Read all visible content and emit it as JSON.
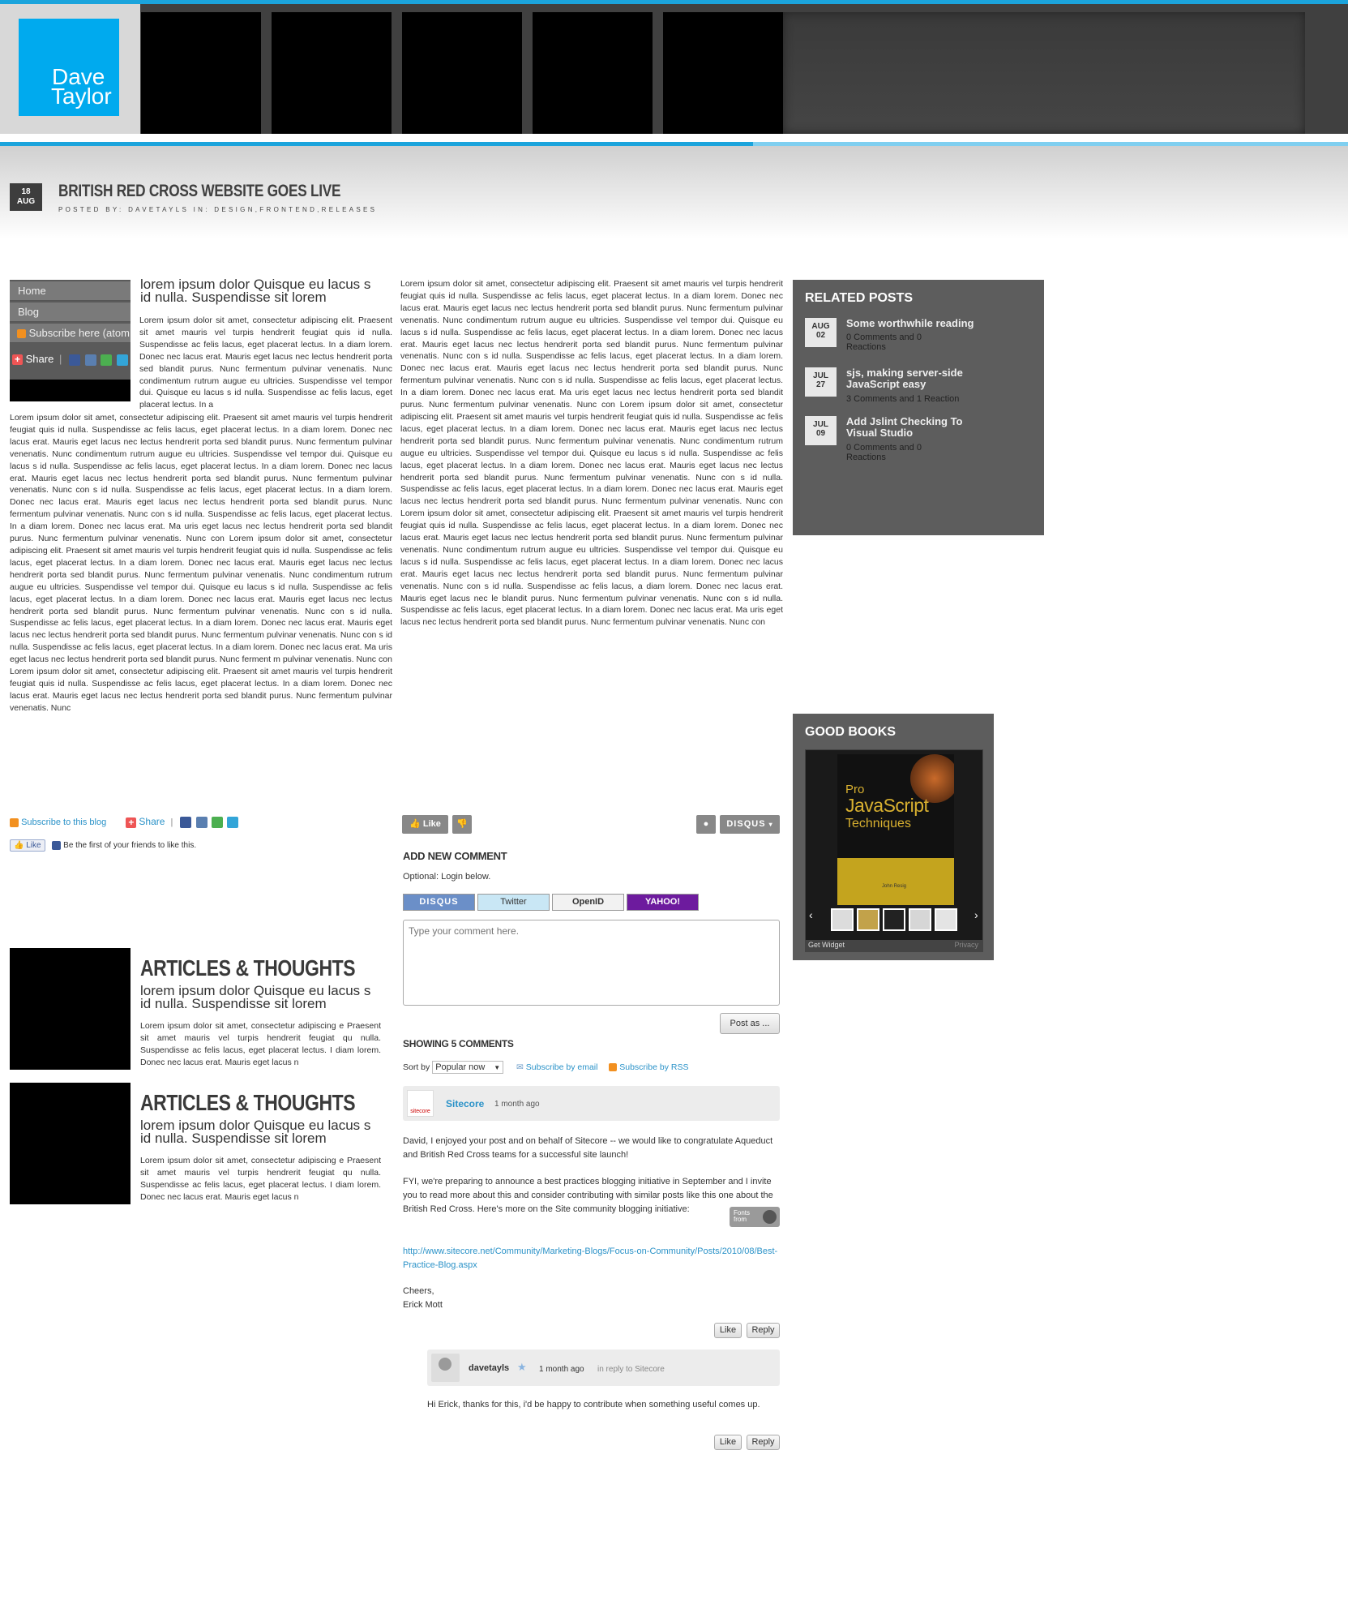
{
  "header": {
    "logo_line1": "Dave",
    "logo_line2": "Taylor"
  },
  "post": {
    "date_day": "18",
    "date_month": "AUG",
    "title": "BRITISH RED CROSS WEBSITE GOES LIVE",
    "meta": "POSTED BY: DAVETAYLS IN: DESIGN,FRONTEND,RELEASES"
  },
  "leftnav": {
    "items": [
      "Home",
      "Blog",
      "Subscribe here (atom"
    ],
    "share": "Share"
  },
  "content": {
    "lead": "lorem ipsum dolor Quisque eu lacus s id nulla. Suspendisse  sit lorem",
    "intro": "Lorem ipsum dolor sit amet, consectetur adipiscing elit. Praesent sit amet mauris vel turpis hendrerit feugiat quis id nulla. Suspendisse ac felis lacus, eget placerat lectus. In a diam lorem. Donec nec lacus erat. Mauris eget lacus nec lectus hendrerit porta sed blandit purus. Nunc fermentum pulvinar venenatis. Nunc condimentum rutrum augue eu ultricies. Suspendisse vel tempor dui. Quisque eu lacus s id nulla. Suspendisse ac felis lacus, eget placerat lectus. In a",
    "col1": "Lorem ipsum dolor sit amet, consectetur adipiscing elit. Praesent sit amet mauris vel turpis hendrerit feugiat quis id nulla. Suspendisse ac felis lacus, eget placerat lectus. In a diam lorem. Donec nec lacus erat. Mauris eget lacus nec lectus hendrerit porta sed blandit purus. Nunc fermentum pulvinar venenatis. Nunc condimentum rutrum augue eu ultricies. Suspendisse vel tempor dui. Quisque eu lacus s id nulla. Suspendisse ac felis lacus, eget placerat lectus. In a diam lorem. Donec nec lacus erat. Mauris eget lacus nec lectus hendrerit porta sed blandit purus. Nunc fermentum pulvinar venenatis. Nunc con s id nulla. Suspendisse ac felis lacus, eget placerat lectus. In a diam lorem. Donec nec lacus erat. Mauris eget lacus nec lectus hendrerit porta sed blandit purus. Nunc fermentum pulvinar venenatis. Nunc con s id nulla. Suspendisse ac felis lacus, eget placerat lectus. In a diam lorem. Donec nec lacus erat. Ma uris eget lacus nec lectus hendrerit porta sed blandit purus. Nunc fermentum pulvinar venenatis. Nunc con Lorem ipsum dolor sit amet, consectetur adipiscing elit. Praesent sit amet mauris vel turpis hendrerit feugiat quis id nulla. Suspendisse ac felis lacus, eget placerat lectus. In a diam lorem. Donec nec lacus erat. Mauris eget lacus nec lectus hendrerit porta sed blandit purus. Nunc fermentum pulvinar venenatis. Nunc condimentum rutrum augue eu ultricies. Suspendisse vel tempor dui. Quisque eu lacus s id nulla. Suspendisse ac felis lacus, eget placerat lectus. In a diam lorem. Donec nec lacus erat. Mauris eget lacus nec lectus hendrerit porta sed blandit purus. Nunc fermentum pulvinar venenatis. Nunc con s id nulla. Suspendisse ac felis lacus, eget placerat lectus. In a diam lorem. Donec nec lacus erat. Mauris eget lacus nec lectus hendrerit porta sed blandit purus. Nunc fermentum pulvinar venenatis. Nunc con s id nulla. Suspendisse ac felis lacus, eget placerat lectus. In a diam lorem. Donec nec lacus erat. Ma uris eget lacus nec lectus hendrerit porta sed blandit purus. Nunc ferment m pulvinar venenatis. Nunc con Lorem ipsum dolor sit amet, consectetur adipiscing elit. Praesent sit amet mauris vel turpis hendrerit feugiat quis id nulla. Suspendisse ac felis lacus, eget placerat lectus. In a diam lorem. Donec nec lacus erat. Mauris eget lacus nec lectus hendrerit porta sed blandit purus. Nunc fermentum pulvinar venenatis. Nunc",
    "col2": "Lorem ipsum dolor sit amet, consectetur adipiscing elit. Praesent sit amet mauris vel turpis hendrerit feugiat quis id nulla. Suspendisse ac felis lacus, eget placerat lectus. In a diam lorem. Donec nec lacus erat. Mauris eget lacus nec lectus hendrerit porta sed blandit purus. Nunc fermentum pulvinar venenatis. Nunc condimentum rutrum augue eu ultricies. Suspendisse vel tempor dui. Quisque eu lacus s id nulla. Suspendisse ac felis lacus, eget placerat lectus. In a diam lorem. Donec nec lacus erat. Mauris eget lacus nec lectus hendrerit porta sed blandit purus. Nunc fermentum pulvinar venenatis. Nunc con s id nulla. Suspendisse ac felis lacus, eget placerat lectus. In a diam lorem. Donec nec lacus erat. Mauris eget lacus nec lectus hendrerit porta sed blandit purus. Nunc fermentum pulvinar venenatis. Nunc con s id nulla. Suspendisse ac felis lacus, eget placerat lectus. In a diam lorem. Donec nec lacus erat. Ma uris eget lacus nec lectus hendrerit porta sed blandit purus. Nunc fermentum pulvinar venenatis. Nunc con Lorem ipsum dolor sit amet, consectetur adipiscing elit. Praesent sit amet mauris vel turpis hendrerit feugiat quis id nulla. Suspendisse ac felis lacus, eget placerat lectus. In a diam lorem. Donec nec lacus erat. Mauris eget lacus nec lectus hendrerit porta sed blandit purus. Nunc fermentum pulvinar venenatis. Nunc condimentum rutrum augue eu ultricies. Suspendisse vel tempor dui. Quisque eu lacus s id nulla. Suspendisse ac felis lacus, eget placerat lectus. In a diam lorem. Donec nec lacus erat. Mauris eget lacus nec lectus hendrerit porta sed blandit purus. Nunc fermentum pulvinar venenatis. Nunc con s id nulla. Suspendisse ac felis lacus, eget placerat lectus. In a diam lorem. Donec nec lacus erat. Mauris eget lacus nec lectus hendrerit porta sed blandit purus. Nunc fermentum pulvinar venenatis. Nunc con Lorem ipsum dolor sit amet, consectetur adipiscing elit. Praesent sit amet mauris vel turpis hendrerit feugiat quis id nulla. Suspendisse ac felis lacus, eget placerat lectus. In a diam lorem. Donec nec lacus erat. Mauris eget lacus nec lectus hendrerit porta sed blandit purus. Nunc fermentum pulvinar venenatis. Nunc condimentum rutrum augue eu ultricies. Suspendisse vel tempor dui. Quisque eu lacus s id nulla. Suspendisse ac felis lacus, eget placerat lectus. In a diam lorem. Donec nec lacus erat. Mauris eget lacus nec lectus hendrerit porta sed blandit purus. Nunc fermentum pulvinar venenatis. Nunc con s id nulla. Suspendisse ac felis lacus, a diam lorem. Donec nec lacus erat. Mauris eget lacus nec le blandit purus. Nunc fermentum pulvinar venenatis. Nunc con s id nulla. Suspendisse ac felis lacus, eget placerat lectus. In a diam lorem. Donec nec lacus erat. Ma uris eget lacus nec lectus hendrerit porta sed blandit purus. Nunc fermentum pulvinar venenatis. Nunc con"
  },
  "share_bar": {
    "subscribe": "Subscribe to this blog",
    "share": "Share",
    "like": "Like",
    "friends": "Be the first of your friends to like this."
  },
  "articles": [
    {
      "heading": "ARTICLES & THOUGHTS",
      "lead": "lorem ipsum dolor Quisque eu lacus s id nulla. Suspendisse  sit lorem",
      "text": "Lorem ipsum dolor sit amet, consectetur adipiscing e Praesent sit amet mauris vel turpis hendrerit feugiat qu nulla. Suspendisse ac felis lacus, eget placerat lectus. I diam lorem. Donec nec lacus erat. Mauris eget lacus n"
    },
    {
      "heading": "ARTICLES & THOUGHTS",
      "lead": "lorem ipsum dolor Quisque eu lacus s id nulla. Suspendisse  sit lorem",
      "text": "Lorem ipsum dolor sit amet, consectetur adipiscing e Praesent sit amet mauris vel turpis hendrerit feugiat qu nulla. Suspendisse ac felis lacus, eget placerat lectus. I diam lorem. Donec nec lacus erat. Mauris eget lacus n"
    }
  ],
  "comments": {
    "like_btn": "Like",
    "disqus_btn": "DISQUS",
    "add_title": "ADD NEW COMMENT",
    "optional": "Optional: Login below.",
    "login": [
      "DISQUS",
      "Twitter",
      "OpenID",
      "YAHOO!"
    ],
    "placeholder": "Type your comment here.",
    "post_as": "Post as ...",
    "showing": "SHOWING 5 COMMENTS",
    "sort_by": "Sort by",
    "sort_value": "Popular now",
    "subscribe_email": "Subscribe by email",
    "subscribe_rss": "Subscribe by RSS",
    "c1": {
      "author": "Sitecore",
      "avatar": "sitecore",
      "time": "1 month ago",
      "p1": "David, I enjoyed your post and on behalf of Sitecore -- we would like to congratulate Aqueduct and British Red Cross teams for a successful site launch!",
      "p2": "FYI, we're preparing to announce a best practices blogging initiative in September and I invite you to read more about this and consider contributing with similar posts like this one about the British Red Cross. Here's more on the Site community blogging initiative:",
      "link": "http://www.sitecore.net/Community/Marketing-Blogs/Focus-on-Community/Posts/2010/08/Best-Practice-Blog.aspx",
      "sign1": "Cheers,",
      "sign2": "Erick Mott",
      "like": "Like",
      "reply": "Reply"
    },
    "c2": {
      "author": "davetayls",
      "time": "1 month ago",
      "in_reply": "in reply to Sitecore",
      "text": "Hi Erick, thanks for this, i'd be happy to contribute when something useful comes up.",
      "like": "Like",
      "reply": "Reply"
    },
    "fonts_from": "Fonts from"
  },
  "sidebar": {
    "related_title": "RELATED POSTS",
    "related": [
      {
        "month": "AUG",
        "day": "02",
        "title": "Some worthwhile reading",
        "meta": "0 Comments and 0 Reactions"
      },
      {
        "month": "JUL",
        "day": "27",
        "title": "sjs, making server-side JavaScript easy",
        "meta": "3 Comments and 1 Reaction"
      },
      {
        "month": "JUL",
        "day": "09",
        "title": "Add Jslint Checking To Visual Studio",
        "meta": "0 Comments and 0 Reactions"
      }
    ],
    "books_title": "GOOD BOOKS",
    "book_title1": "Pro",
    "book_title2": "JavaScript",
    "book_title3": "Techniques",
    "book_author": "John Resig",
    "get_widget": "Get Widget",
    "privacy": "Privacy"
  },
  "colors": {
    "accent": "#1ba4dc",
    "panel": "#5d5d5d",
    "link": "#2a92c8"
  }
}
